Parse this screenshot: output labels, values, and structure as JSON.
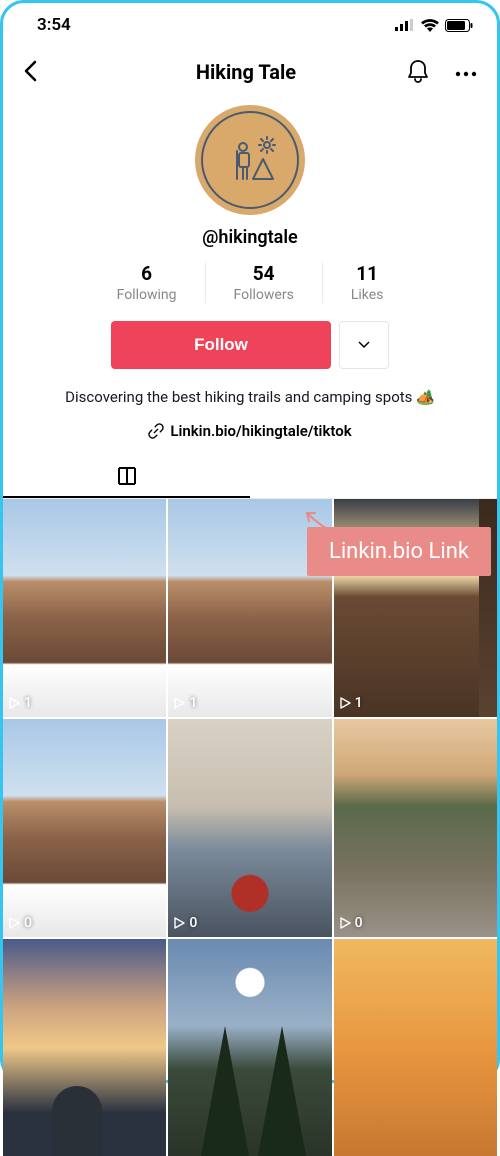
{
  "status": {
    "time": "3:54"
  },
  "nav": {
    "title": "Hiking Tale"
  },
  "profile": {
    "username": "@hikingtale",
    "stats": {
      "following": {
        "count": "6",
        "label": "Following"
      },
      "followers": {
        "count": "54",
        "label": "Followers"
      },
      "likes": {
        "count": "11",
        "label": "Likes"
      }
    },
    "follow_label": "Follow",
    "bio": "Discovering the best hiking trails and camping spots 🏕️",
    "link": "Linkin.bio/hikingtale/tiktok"
  },
  "callout": {
    "label": "Linkin.bio Link"
  },
  "grid": {
    "items": [
      {
        "views": "1"
      },
      {
        "views": "1"
      },
      {
        "views": "1"
      },
      {
        "views": "0"
      },
      {
        "views": "0"
      },
      {
        "views": "0"
      },
      {
        "views": ""
      },
      {
        "views": ""
      },
      {
        "views": ""
      }
    ]
  }
}
